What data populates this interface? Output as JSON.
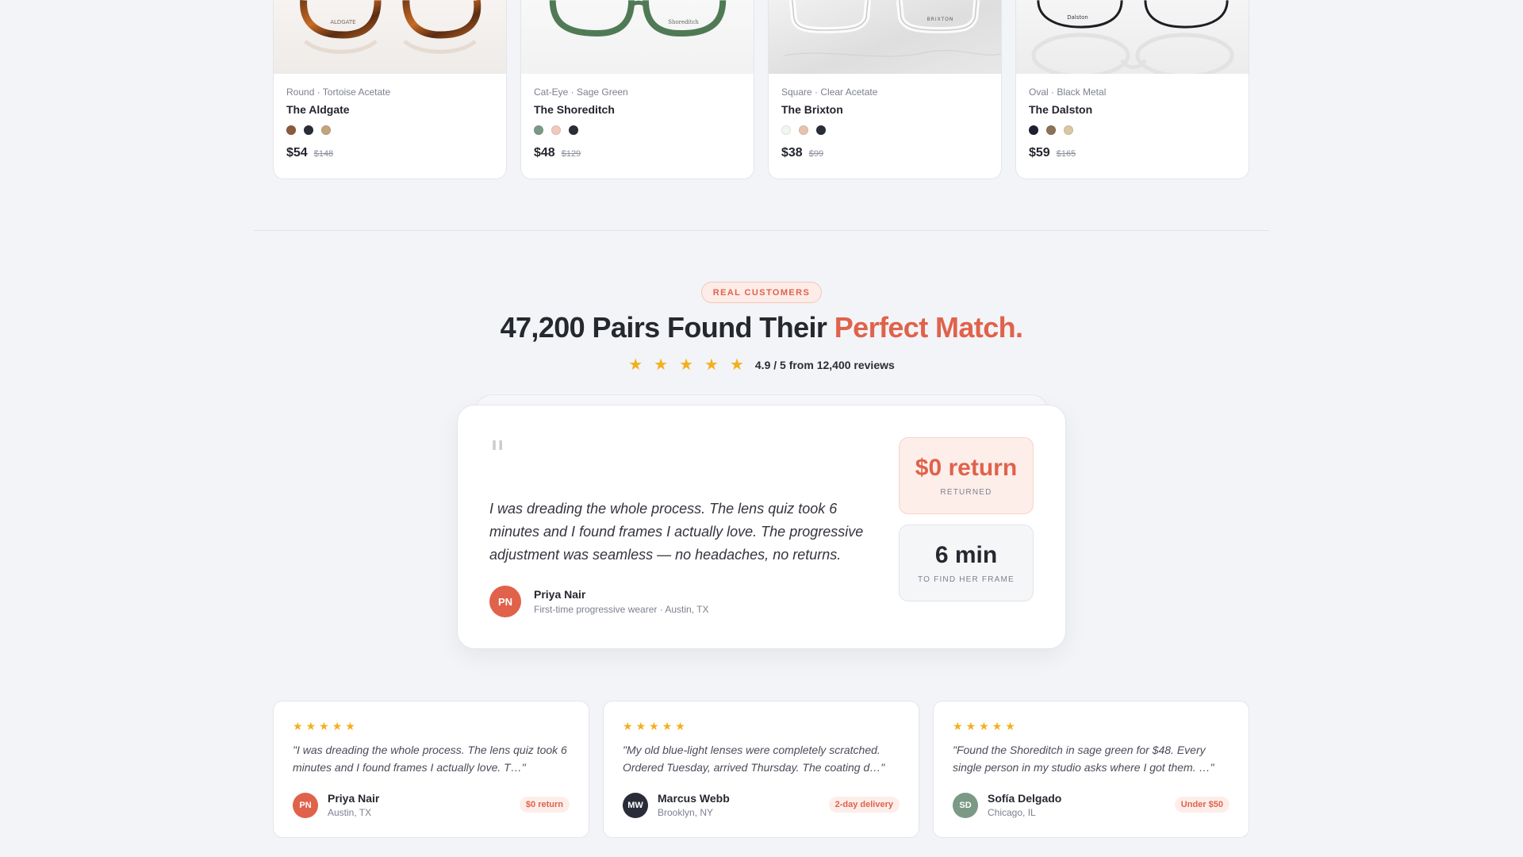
{
  "products": [
    {
      "meta": "Round · Tortoise Acetate",
      "name": "The Aldgate",
      "engraving": "ALDGATE",
      "price": "$54",
      "old_price": "$148",
      "swatches": [
        "#8a5a3b",
        "#2a2d38",
        "#c2a47d"
      ],
      "image": "tortoise-round-frames"
    },
    {
      "meta": "Cat-Eye · Sage Green",
      "name": "The Shoreditch",
      "engraving": "Shoreditch",
      "price": "$48",
      "old_price": "$129",
      "swatches": [
        "#7b9a86",
        "#f0c9bd",
        "#2a2d38"
      ],
      "image": "sage-cat-eye-frames"
    },
    {
      "meta": "Square · Clear Acetate",
      "name": "The Brixton",
      "engraving": "BRIXTON",
      "price": "$38",
      "old_price": "$99",
      "swatches": [
        "#f4f4f2",
        "#e5c3ae",
        "#2a2d38"
      ],
      "image": "clear-square-frames"
    },
    {
      "meta": "Oval · Black Metal",
      "name": "The Dalston",
      "engraving": "Dalston",
      "price": "$59",
      "old_price": "$165",
      "swatches": [
        "#1e2030",
        "#8a7157",
        "#d9c7a2"
      ],
      "image": "black-metal-oval-frames"
    }
  ],
  "social_proof": {
    "eyebrow": "REAL CUSTOMERS",
    "headline_main": "47,200 Pairs Found Their ",
    "headline_accent": "Perfect Match.",
    "star_count": 5,
    "rating_text": "4.9 / 5 from 12,400 reviews"
  },
  "featured": {
    "quote_mark": "\"",
    "quote": "I was dreading the whole process. The lens quiz took 6 minutes and I found frames I actually love. The progressive adjustment was seamless — no headaches, no returns.",
    "initials": "PN",
    "name": "Priya Nair",
    "subtitle": "First-time progressive wearer · Austin, TX",
    "stats": [
      {
        "value": "$0 return",
        "label": "RETURNED"
      },
      {
        "value": "6 min",
        "label": "TO FIND HER FRAME"
      }
    ]
  },
  "reviews": [
    {
      "text": "\"I was dreading the whole process. The lens quiz took 6 minutes and I found frames I actually love. T…\"",
      "initials": "PN",
      "avatar_color": "#e0624b",
      "name": "Priya Nair",
      "location": "Austin, TX",
      "badge": "$0 return"
    },
    {
      "text": "\"My old blue-light lenses were completely scratched. Ordered Tuesday, arrived Thursday. The coating d…\"",
      "initials": "MW",
      "avatar_color": "#2a2d38",
      "name": "Marcus Webb",
      "location": "Brooklyn, NY",
      "badge": "2-day delivery"
    },
    {
      "text": "\"Found the Shoreditch in sage green for $48. Every single person in my studio asks where I got them. …\"",
      "initials": "SD",
      "avatar_color": "#7b9a86",
      "name": "Sofía Delgado",
      "location": "Chicago, IL",
      "badge": "Under $50"
    }
  ],
  "colors": {
    "accent": "#e0624b",
    "star": "#f2b01e",
    "background": "#f3f4f7"
  }
}
